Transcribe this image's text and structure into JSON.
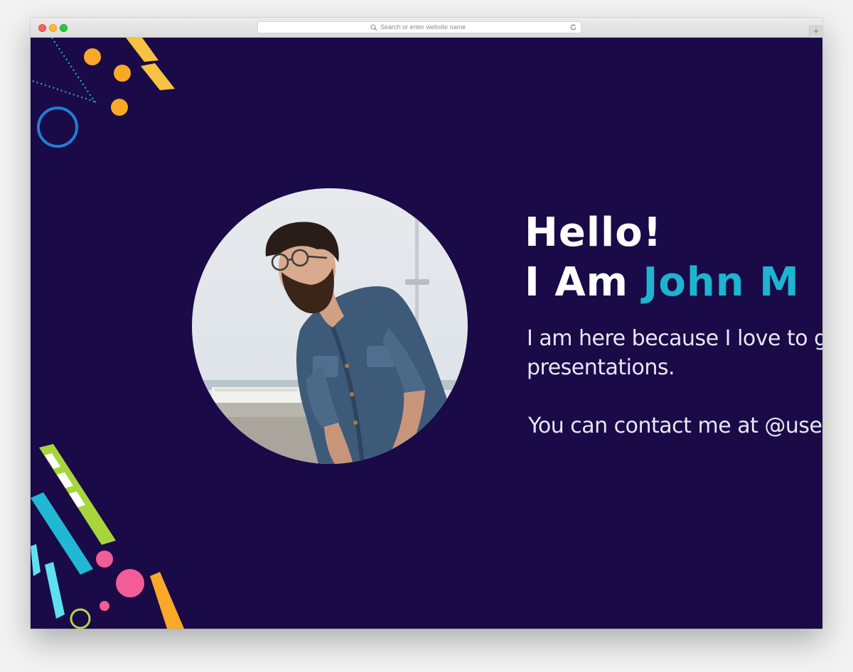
{
  "browser": {
    "url_placeholder": "Search or enter website name",
    "new_tab_label": "+"
  },
  "slide": {
    "background_color": "#1a0a48",
    "accent_color": "#1db4cf",
    "greeting": "Hello!",
    "intro_prefix": "I Am ",
    "name": "John M",
    "bio_line1": "I am here because I love to g",
    "bio_line2": "presentations.",
    "contact": "You can contact me at @use"
  }
}
